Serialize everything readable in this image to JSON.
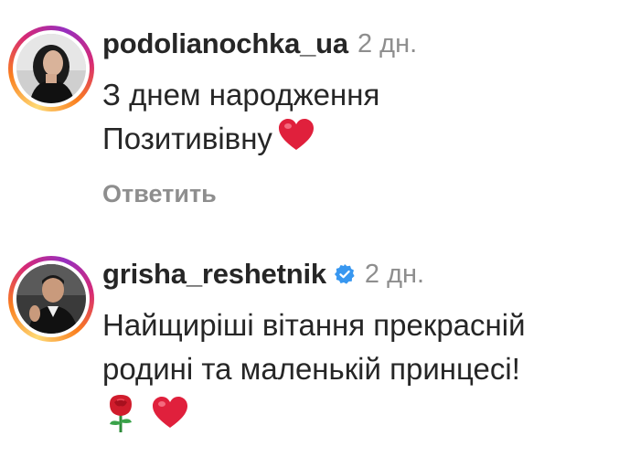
{
  "comments": [
    {
      "username": "podolianochka_ua",
      "time": "2 дн.",
      "text_lines": [
        "З днем народження",
        "Позитивівну"
      ],
      "emoji_icons": [
        "red-heart-icon"
      ],
      "reply_label": "Ответить",
      "verified": false
    },
    {
      "username": "grisha_reshetnik",
      "time": "2 дн.",
      "text_lines": [
        "Найщиріші вітання прекрасній",
        "родині та маленькій принцесі!"
      ],
      "emoji_icons": [
        "rose-icon",
        "red-heart-icon"
      ],
      "verified": true
    }
  ],
  "colors": {
    "text": "#262626",
    "muted": "#8e8e8e",
    "verified_badge": "#3897f0",
    "heart": "#e0203c"
  }
}
